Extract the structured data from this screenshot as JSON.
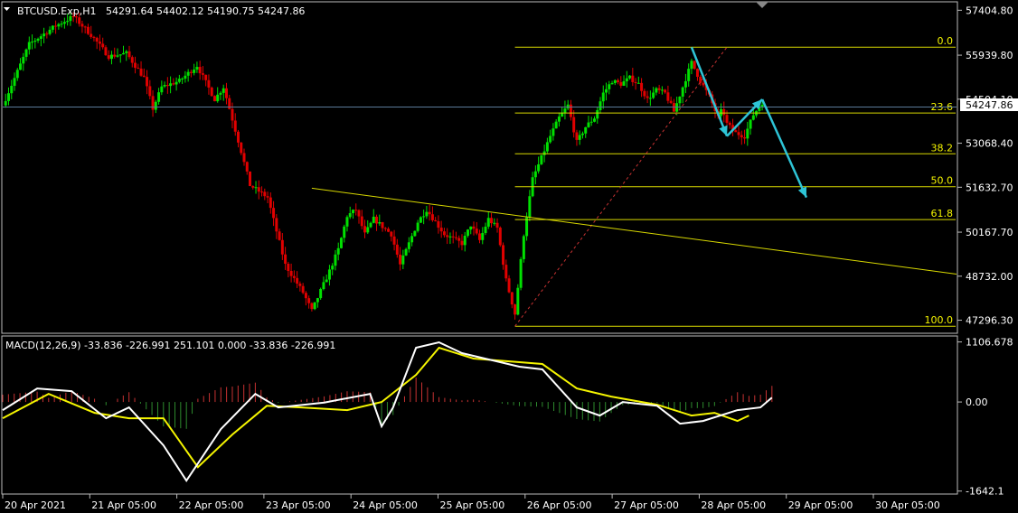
{
  "header": {
    "symbol": "BTCUSD.Exp,H1",
    "ohlc": "54291.64 54402.12 54190.75 54247.86",
    "macd_label": "MACD(12,26,9) -33.836 -226.991 251.101 0.000 -33.836 -226.991"
  },
  "colors": {
    "background": "#000000",
    "bull": "#00e000",
    "bear": "#e00000",
    "macd_line": "#ffffff",
    "signal_line": "#f5f500",
    "hist_pos": "#c83232",
    "hist_neg": "#2e8b2e",
    "fib": "#d8d800",
    "arrow": "#2ec4d6",
    "price_line": "#5b7a9a"
  },
  "chart_data": [
    {
      "type": "candlestick",
      "title": "BTCUSD.Exp,H1",
      "x_labels": [
        "20 Apr 2021",
        "21 Apr 05:00",
        "22 Apr 05:00",
        "23 Apr 05:00",
        "24 Apr 05:00",
        "25 Apr 05:00",
        "26 Apr 05:00",
        "27 Apr 05:00",
        "28 Apr 05:00",
        "29 Apr 05:00",
        "30 Apr 05:00"
      ],
      "y_ticks": [
        "57404.80",
        "55939.80",
        "54504.10",
        "53068.40",
        "51632.70",
        "50167.70",
        "48732.00",
        "47296.30"
      ],
      "ylim": [
        46900,
        57650
      ],
      "current_price": "54247.86",
      "path": [
        [
          0,
          54300
        ],
        [
          3,
          56300
        ],
        [
          6,
          56900
        ],
        [
          8,
          57200
        ],
        [
          10,
          56600
        ],
        [
          12,
          55900
        ],
        [
          14,
          56000
        ],
        [
          16,
          55200
        ],
        [
          17,
          54200
        ],
        [
          18,
          54900
        ],
        [
          20,
          55100
        ],
        [
          22,
          55600
        ],
        [
          24,
          54500
        ],
        [
          25,
          54900
        ],
        [
          27,
          52800
        ],
        [
          28,
          51700
        ],
        [
          30,
          51300
        ],
        [
          32,
          49100
        ],
        [
          34,
          48200
        ],
        [
          35,
          47600
        ],
        [
          37,
          48900
        ],
        [
          38,
          49600
        ],
        [
          39,
          50700
        ],
        [
          40,
          50900
        ],
        [
          41,
          50100
        ],
        [
          42,
          50600
        ],
        [
          44,
          50100
        ],
        [
          45,
          49100
        ],
        [
          47,
          50500
        ],
        [
          48,
          50900
        ],
        [
          50,
          50100
        ],
        [
          52,
          49800
        ],
        [
          53,
          50400
        ],
        [
          54,
          49900
        ],
        [
          55,
          50600
        ],
        [
          56,
          50300
        ],
        [
          57,
          48600
        ],
        [
          58,
          47500
        ],
        [
          59,
          50100
        ],
        [
          60,
          51900
        ],
        [
          61,
          52600
        ],
        [
          62,
          53300
        ],
        [
          63,
          53900
        ],
        [
          64,
          54300
        ],
        [
          65,
          53100
        ],
        [
          66,
          53600
        ],
        [
          67,
          53900
        ],
        [
          68,
          54700
        ],
        [
          69,
          55100
        ],
        [
          70,
          55000
        ],
        [
          71,
          55200
        ],
        [
          72,
          55000
        ],
        [
          73,
          54500
        ],
        [
          74,
          54800
        ],
        [
          75,
          54700
        ],
        [
          76,
          54100
        ],
        [
          77,
          54900
        ],
        [
          78,
          55700
        ],
        [
          79,
          55100
        ],
        [
          80,
          54600
        ],
        [
          81,
          53900
        ],
        [
          81.5,
          54200
        ],
        [
          82,
          53700
        ],
        [
          83,
          53400
        ],
        [
          84,
          53300
        ],
        [
          85,
          54000
        ],
        [
          86,
          54400
        ]
      ],
      "fibonacci": {
        "levels": [
          "0.0",
          "23.6",
          "38.2",
          "50.0",
          "61.8",
          "100.0"
        ],
        "high": 56200,
        "low": 47100
      },
      "trendline": {
        "from": [
          35,
          51600
        ],
        "to": [
          108,
          48800
        ]
      },
      "zigzag_arrows": [
        [
          [
            78,
            56200
          ],
          [
            82,
            53300
          ]
        ],
        [
          [
            82,
            53300
          ],
          [
            86,
            54500
          ]
        ],
        [
          [
            86,
            54500
          ],
          [
            91,
            51300
          ]
        ]
      ]
    },
    {
      "type": "macd",
      "title": "MACD(12,26,9)",
      "y_ticks": [
        "1106.678",
        "0.00",
        "-1642.1"
      ],
      "ylim": [
        -1680,
        1200
      ],
      "macd_path": [
        [
          0,
          -150
        ],
        [
          3,
          250
        ],
        [
          6,
          200
        ],
        [
          9,
          -300
        ],
        [
          11,
          -100
        ],
        [
          14,
          -800
        ],
        [
          16,
          -1450
        ],
        [
          19,
          -500
        ],
        [
          22,
          150
        ],
        [
          24,
          -100
        ],
        [
          28,
          -10
        ],
        [
          32,
          150
        ],
        [
          33,
          -450
        ],
        [
          34,
          -100
        ],
        [
          36,
          1000
        ],
        [
          38,
          1100
        ],
        [
          40,
          900
        ],
        [
          43,
          750
        ],
        [
          45,
          650
        ],
        [
          47,
          600
        ],
        [
          50,
          -100
        ],
        [
          52,
          -250
        ],
        [
          54,
          0
        ],
        [
          57,
          -70
        ],
        [
          59,
          -400
        ],
        [
          61,
          -350
        ],
        [
          64,
          -150
        ],
        [
          66,
          -100
        ],
        [
          67,
          80
        ]
      ],
      "signal_path": [
        [
          0,
          -300
        ],
        [
          4,
          150
        ],
        [
          8,
          -200
        ],
        [
          11,
          -300
        ],
        [
          14,
          -300
        ],
        [
          17,
          -1200
        ],
        [
          20,
          -600
        ],
        [
          23,
          -70
        ],
        [
          26,
          -100
        ],
        [
          30,
          -150
        ],
        [
          33,
          0
        ],
        [
          36,
          500
        ],
        [
          38,
          1000
        ],
        [
          41,
          800
        ],
        [
          44,
          750
        ],
        [
          47,
          700
        ],
        [
          50,
          250
        ],
        [
          53,
          100
        ],
        [
          57,
          -50
        ],
        [
          60,
          -250
        ],
        [
          62,
          -200
        ],
        [
          64,
          -350
        ],
        [
          65,
          -250
        ]
      ]
    }
  ]
}
